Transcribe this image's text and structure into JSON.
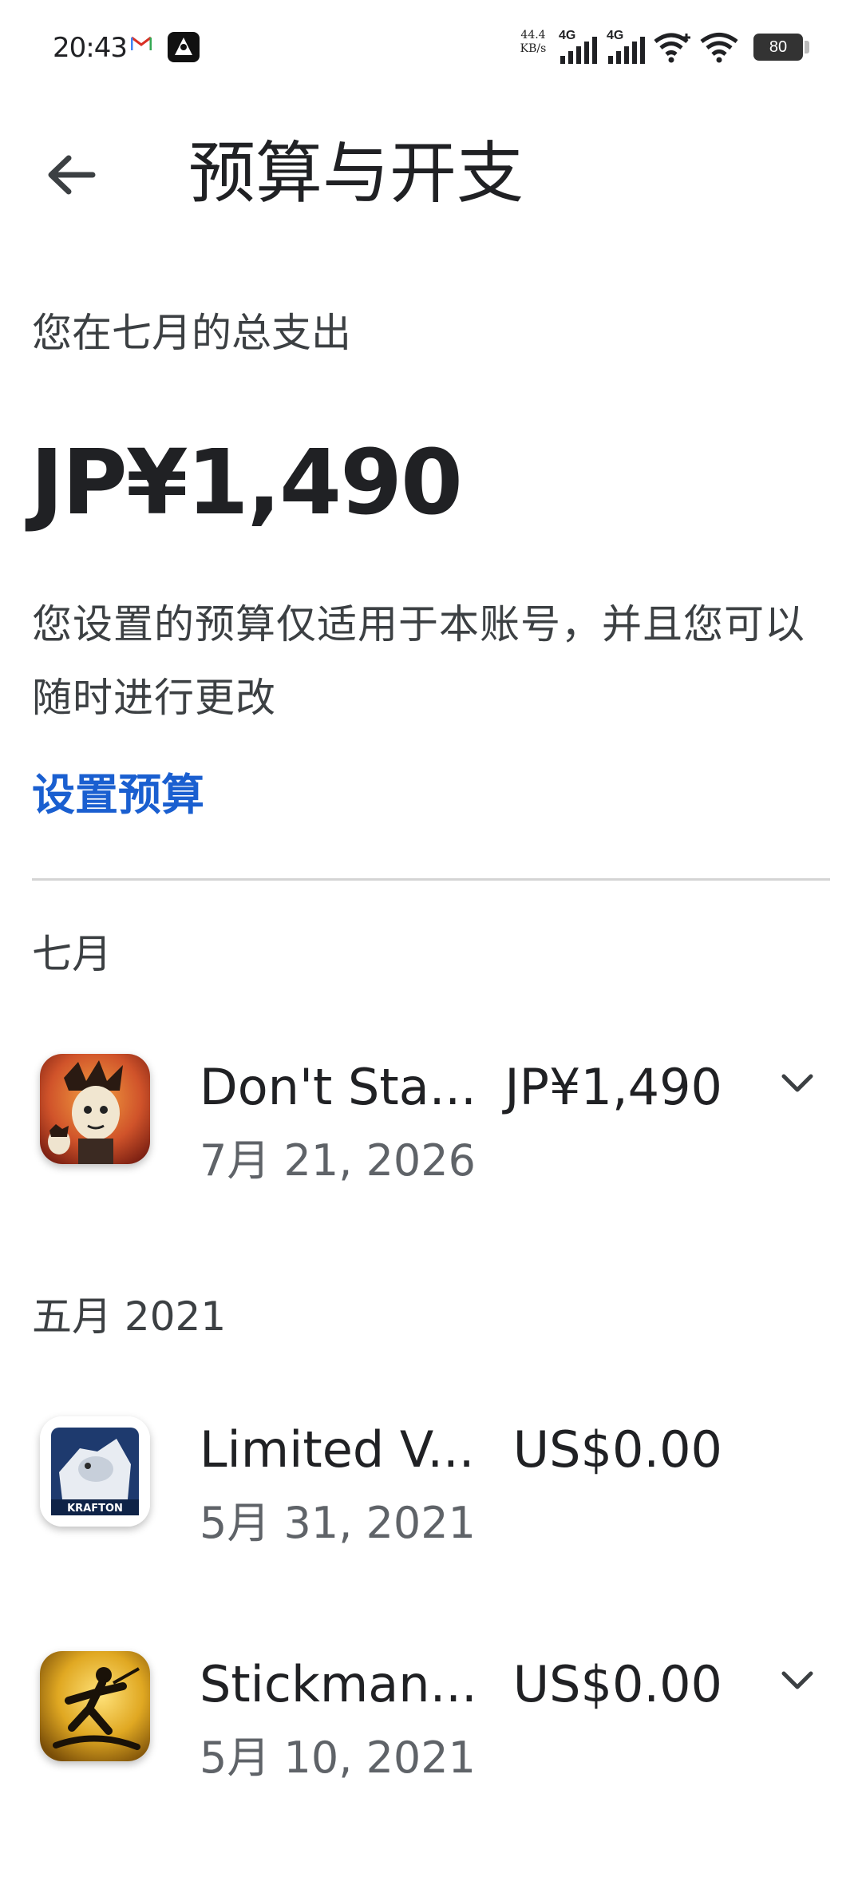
{
  "status_bar": {
    "time": "20:43",
    "net_speed_value": "44.4",
    "net_speed_unit": "KB/s",
    "signal_1_label": "4G",
    "signal_2_label": "4G",
    "battery_level": "80"
  },
  "header": {
    "title": "预算与开支",
    "back_icon": "arrow-back-icon"
  },
  "summary": {
    "label": "您在七月的总支出",
    "amount": "JP¥1,490",
    "budget_note": "您设置的预算仅适用于本账号，并且您可以随时进行更改",
    "set_budget_label": "设置预算"
  },
  "groups": [
    {
      "month": "七月",
      "transactions": [
        {
          "name": "Don't Sta...",
          "date": "7月 21, 2026",
          "amount": "JP¥1,490",
          "expandable": true
        }
      ]
    },
    {
      "month": "五月 2021",
      "transactions": [
        {
          "name": "Limited V...",
          "date": "5月 31, 2021",
          "amount": "US$0.00",
          "expandable": false
        },
        {
          "name": "Stickman...",
          "date": "5月 10, 2021",
          "amount": "US$0.00",
          "expandable": true
        }
      ]
    }
  ],
  "colors": {
    "link": "#1a5fd0",
    "text_primary": "#202124",
    "text_secondary": "#5f6368",
    "divider": "#d4d4d4"
  }
}
